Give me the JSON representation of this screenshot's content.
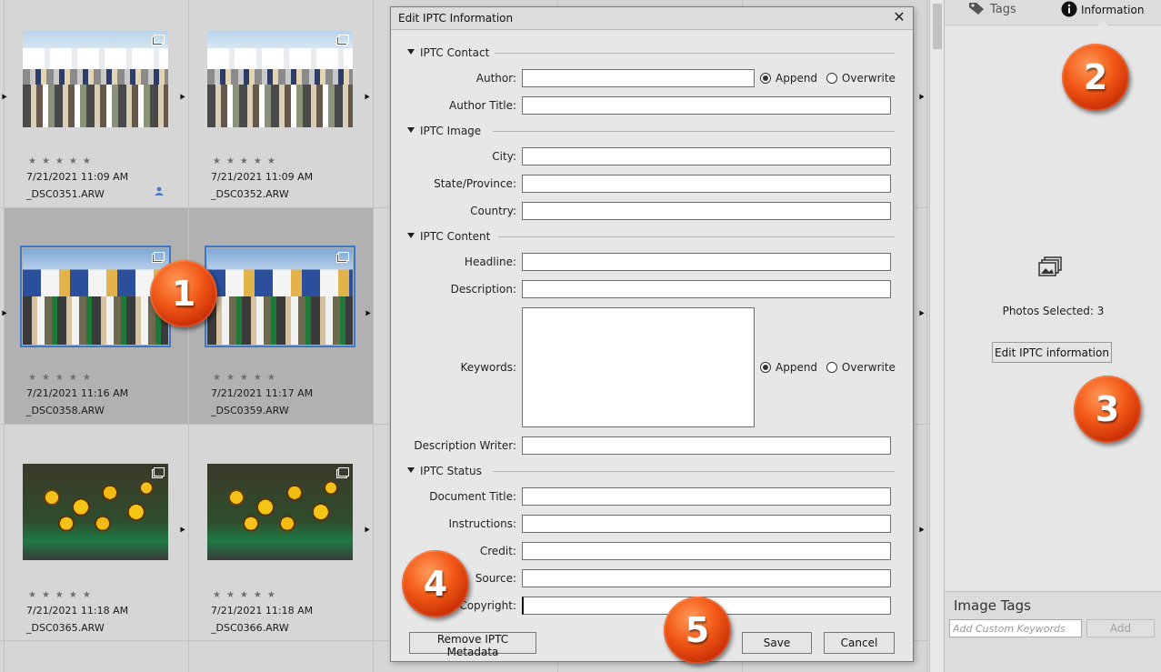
{
  "grid": {
    "cells": [
      {
        "date": "7/21/2021 11:09 AM",
        "file": "_DSC0351.ARW",
        "stars": "★★★★★"
      },
      {
        "date": "7/21/2021 11:09 AM",
        "file": "_DSC0352.ARW",
        "stars": "★★★★★"
      },
      {
        "date": "7/21/2021 11:16 AM",
        "file": "_DSC0358.ARW",
        "stars": "★★★★★"
      },
      {
        "date": "7/21/2021 11:17 AM",
        "file": "_DSC0359.ARW",
        "stars": "★★★★★"
      },
      {
        "date": "7/21/2021 11:18 AM",
        "file": "_DSC0365.ARW",
        "stars": "★★★★★"
      },
      {
        "date": "7/21/2021 11:18 AM",
        "file": "_DSC0366.ARW",
        "stars": "★★★★★"
      }
    ],
    "arrow_glyph": "⯈",
    "check_glyph": "✓"
  },
  "panel": {
    "tabs": [
      {
        "label": "Tags",
        "icon": "tag-icon"
      },
      {
        "label": "Information",
        "icon": "info-icon"
      }
    ],
    "photos_selected": "Photos Selected: 3",
    "edit_button": "Edit IPTC information",
    "image_tags_title": "Image Tags",
    "keyword_placeholder": "Add Custom Keywords",
    "add_button": "Add"
  },
  "dialog": {
    "title": "Edit IPTC Information",
    "close": "✕",
    "sections": {
      "contact": "IPTC Contact",
      "image": "IPTC Image",
      "content": "IPTC Content",
      "status": "IPTC Status"
    },
    "labels": {
      "author": "Author:",
      "author_title": "Author Title:",
      "city": "City:",
      "state": "State/Province:",
      "country": "Country:",
      "headline": "Headline:",
      "description": "Description:",
      "keywords": "Keywords:",
      "description_writer": "Description Writer:",
      "document_title": "Document Title:",
      "instructions": "Instructions:",
      "credit": "Credit:",
      "source": "Source:",
      "copyright": "Copyright:"
    },
    "values": {
      "author": "",
      "author_title": "",
      "city": "",
      "state": "",
      "country": "",
      "headline": "",
      "description": "",
      "keywords": "",
      "description_writer": "",
      "document_title": "",
      "instructions": "",
      "credit": "",
      "source": "",
      "copyright": ""
    },
    "append": "Append",
    "overwrite": "Overwrite",
    "author_mode": "Append",
    "keywords_mode": "Append",
    "remove_button": "Remove IPTC Metadata",
    "save_button": "Save",
    "cancel_button": "Cancel"
  },
  "callouts": [
    "1",
    "2",
    "3",
    "4",
    "5"
  ],
  "colors": {
    "selection": "#3c78c8",
    "callout": "#f35a17"
  }
}
